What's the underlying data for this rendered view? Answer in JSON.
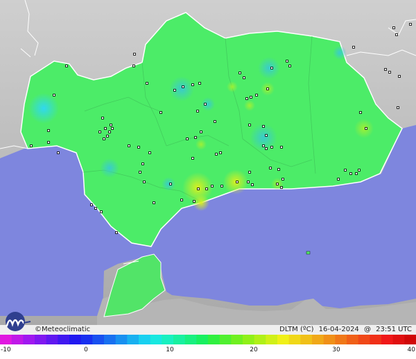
{
  "brand": {
    "copyright_symbol": "©",
    "name": "Meteoclimatic"
  },
  "caption": {
    "variable": "DLTM (ºC)",
    "date": "16-04-2024",
    "at": "@",
    "time": "23:51 UTC"
  },
  "scale": {
    "ticks": [
      "-10",
      "0",
      "10",
      "20",
      "30",
      "40"
    ]
  },
  "colors": {
    "sea": "#7e86de",
    "land_outside": "#b9b9b9",
    "region_green": "#4cec68",
    "border": "#ffffff"
  },
  "icons": {
    "logo": "meteoclimatic-logo",
    "station": "station-marker"
  }
}
